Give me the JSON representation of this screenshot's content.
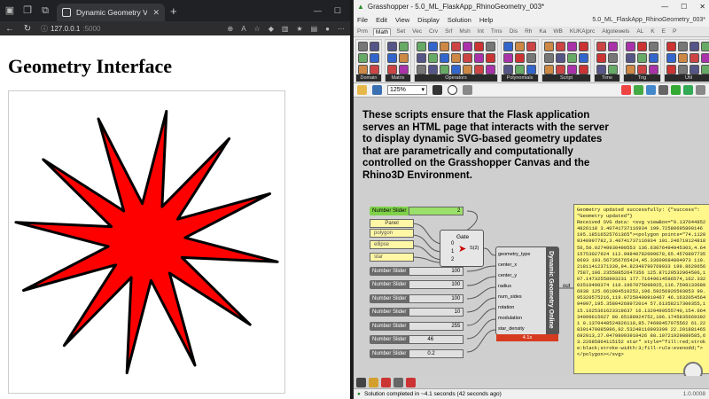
{
  "browser": {
    "tab_title": "Dynamic Geometry Viewer",
    "url_host": "127.0.0.1",
    "url_port": ":5000",
    "page_title": "Geometry Interface"
  },
  "star": {
    "points": 12,
    "fill": "#ff0000",
    "stroke": "#000000",
    "outer_radius_frac": 0.48,
    "inner_radius_frac": 0.14
  },
  "grasshopper": {
    "window_title": "Grasshopper - 5.0_ML_FlaskApp_RhinoGeometry_003*",
    "menu": [
      "File",
      "Edit",
      "View",
      "Display",
      "Solution",
      "Help"
    ],
    "doc_name": "5.0_ML_FlaskApp_RhinoGeometry_003*",
    "tabs": [
      "Prm",
      "Math",
      "Set",
      "Vec",
      "Crv",
      "Srf",
      "Msh",
      "Int",
      "Trns",
      "Dis",
      "Rh",
      "Ka",
      "WB",
      "KUKA|prc",
      "Algolewels",
      "AL",
      "K",
      "E",
      "P"
    ],
    "active_tab": "Math",
    "ribbon_groups": [
      "Domain",
      "Matrix",
      "Operators",
      "Polynomials",
      "Script",
      "Time",
      "Trig",
      "Util"
    ],
    "zoom": "125%",
    "note": "These scripts ensure that the Flask application serves an HTML page that interacts with the server to display dynamic SVG-based geometry updates that are parametrically and computationally controlled on the Grasshopper Canvas and the Rhino3D Environment.",
    "sliders": [
      {
        "label": "Number Slider",
        "value": "2"
      },
      {
        "label": "Number Slider",
        "value": "100"
      },
      {
        "label": "Number Slider",
        "value": "100"
      },
      {
        "label": "Number Slider",
        "value": "100"
      },
      {
        "label": "Number Slider",
        "value": "10"
      },
      {
        "label": "Number Slider",
        "value": "255"
      },
      {
        "label": "Number Slider",
        "value": "46"
      },
      {
        "label": "Number Slider",
        "value": "0.2"
      }
    ],
    "panels": {
      "header": "Panel",
      "polygon": "polygon",
      "ellipse": "ellipse",
      "star": "star"
    },
    "gate": {
      "title": "Gate",
      "inputs": [
        "0",
        "1",
        "2"
      ],
      "output": "S(2)"
    },
    "component": {
      "name": "Dynamic Geometry Online",
      "inputs": [
        "geometry_type",
        "center_x",
        "center_y",
        "radius",
        "num_sides",
        "rotation",
        "modulation",
        "star_density"
      ],
      "output": "out",
      "error": "4.1s"
    },
    "output_text": "Geometry updated successfully: {\"success\": \"Geometry updated\"}\nReceived SVG data: <svg viewBox=\"0.1370448524826118 3.40741737116934 199.72580695800146 195.18516525761365\"><polygon points=\"74.11209348997782,3.40741737116934 101.24671912481856,50.02749930490553 136.63076494945303,4.6415753027924 112.99840782009678,65.45708077350693 193.567356765424,45.33609684804973 119.21811412371339,94.82348790769933 199.86296567587,106.23558852647356 125.87120532964506,107.14732558993231 177.71649614586574,162.33203510490374 110.1967075098925,116.75981336896938 125.661904510252,196.59256926593053 90.95320575216,119.97250409910467 46.163205456494997,195.35804268972014 57.61358217300355,115.1625361623319637 16.1329490555740,154.66434099615027 80.65188924752,106.17458356693921 0.1370448524826118,85.74690457075562 61.228391470085996,92.53248110993399 22.201881465692013,27.04798093910426 88.10721929889585,63.22685864115152 star\" style=\"fill:red;stroke:black;stroke-width:3;fill-rule:evenodd;\"></polygon></svg>",
    "status": "Solution completed in ~4.1 seconds (42 seconds ago)",
    "version": "1.0.0008"
  }
}
